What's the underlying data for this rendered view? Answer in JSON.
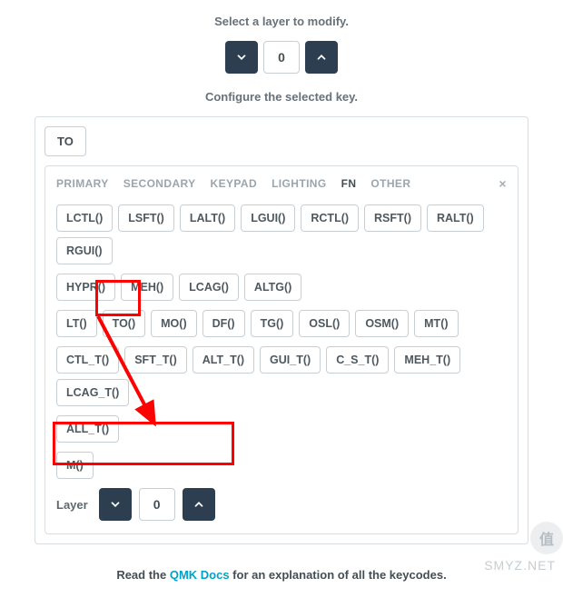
{
  "instruction1": "Select a layer to modify.",
  "instruction2": "Configure the selected key.",
  "topStepper": {
    "value": "0"
  },
  "selectedKey": "TO",
  "tabs": {
    "primary": "PRIMARY",
    "secondary": "SECONDARY",
    "keypad": "KEYPAD",
    "lighting": "LIGHTING",
    "fn": "FN",
    "other": "OTHER"
  },
  "closeGlyph": "×",
  "row1": {
    "k0": "LCTL()",
    "k1": "LSFT()",
    "k2": "LALT()",
    "k3": "LGUI()",
    "k4": "RCTL()",
    "k5": "RSFT()",
    "k6": "RALT()",
    "k7": "RGUI()"
  },
  "row2": {
    "k0": "HYPR()",
    "k1": "MEH()",
    "k2": "LCAG()",
    "k3": "ALTG()"
  },
  "row3": {
    "k0": "LT()",
    "k1": "TO()",
    "k2": "MO()",
    "k3": "DF()",
    "k4": "TG()",
    "k5": "OSL()",
    "k6": "OSM()",
    "k7": "MT()"
  },
  "row4": {
    "k0": "CTL_T()",
    "k1": "SFT_T()",
    "k2": "ALT_T()",
    "k3": "GUI_T()",
    "k4": "C_S_T()",
    "k5": "MEH_T()",
    "k6": "LCAG_T()"
  },
  "row5": {
    "k0": "ALL_T()"
  },
  "row6": {
    "k0": "M()"
  },
  "layer": {
    "label": "Layer",
    "value": "0"
  },
  "footer": {
    "pre": "Read the ",
    "link": "QMK Docs",
    "post": " for an explanation of all the keycodes."
  },
  "watermark": "SMYZ.NET",
  "wmIcon": "值"
}
